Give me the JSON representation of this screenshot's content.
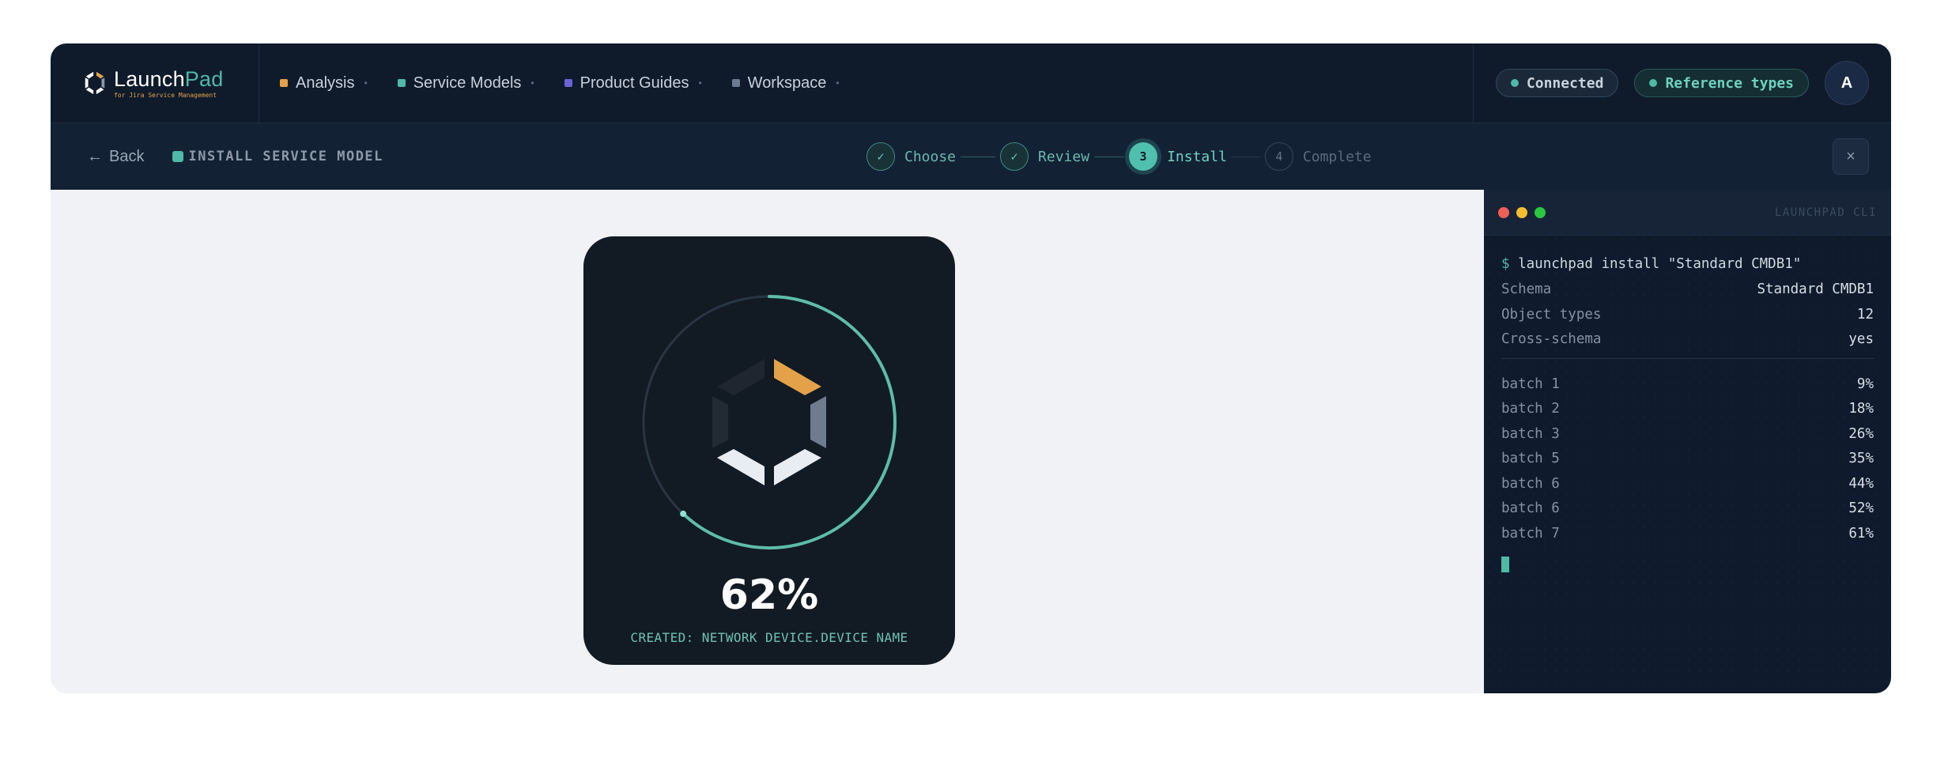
{
  "brand": {
    "name_main": "Launch",
    "name_accent": "Pad",
    "subtitle": "for Jira Service Management"
  },
  "nav": {
    "items": [
      {
        "label": "Analysis",
        "color": "#e3a24a"
      },
      {
        "label": "Service Models",
        "color": "#4fb8a6"
      },
      {
        "label": "Product Guides",
        "color": "#6b63d6"
      },
      {
        "label": "Workspace",
        "color": "#6b7a90"
      }
    ],
    "status_connected": "Connected",
    "status_reference": "Reference types",
    "avatar_initial": "A"
  },
  "subbar": {
    "back_label": "Back",
    "section_label": "INSTALL SERVICE MODEL",
    "close_icon": "×",
    "steps": [
      {
        "marker": "✓",
        "label": "Choose",
        "state": "done"
      },
      {
        "marker": "✓",
        "label": "Review",
        "state": "done"
      },
      {
        "marker": "3",
        "label": "Install",
        "state": "active"
      },
      {
        "marker": "4",
        "label": "Complete",
        "state": "todo"
      }
    ]
  },
  "progress": {
    "percent_text": "62%",
    "fraction": 0.62,
    "status_text": "CREATED: NETWORK DEVICE.DEVICE NAME",
    "accent_color": "#5dbda9"
  },
  "cli": {
    "title": "LAUNCHPAD CLI",
    "prompt": "$",
    "command": "launchpad install \"Standard CMDB1\"",
    "info": [
      {
        "key": "Schema",
        "value": "Standard CMDB1"
      },
      {
        "key": "Object types",
        "value": "12"
      },
      {
        "key": "Cross-schema",
        "value": "yes"
      }
    ],
    "batches": [
      {
        "key": "batch 1",
        "value": "9%"
      },
      {
        "key": "batch 2",
        "value": "18%"
      },
      {
        "key": "batch 3",
        "value": "26%"
      },
      {
        "key": "batch 5",
        "value": "35%"
      },
      {
        "key": "batch 6",
        "value": "44%"
      },
      {
        "key": "batch 6",
        "value": "52%"
      },
      {
        "key": "batch 7",
        "value": "61%"
      }
    ],
    "traffic_colors": [
      "#ef5f57",
      "#f5bf2f",
      "#29c840"
    ]
  }
}
